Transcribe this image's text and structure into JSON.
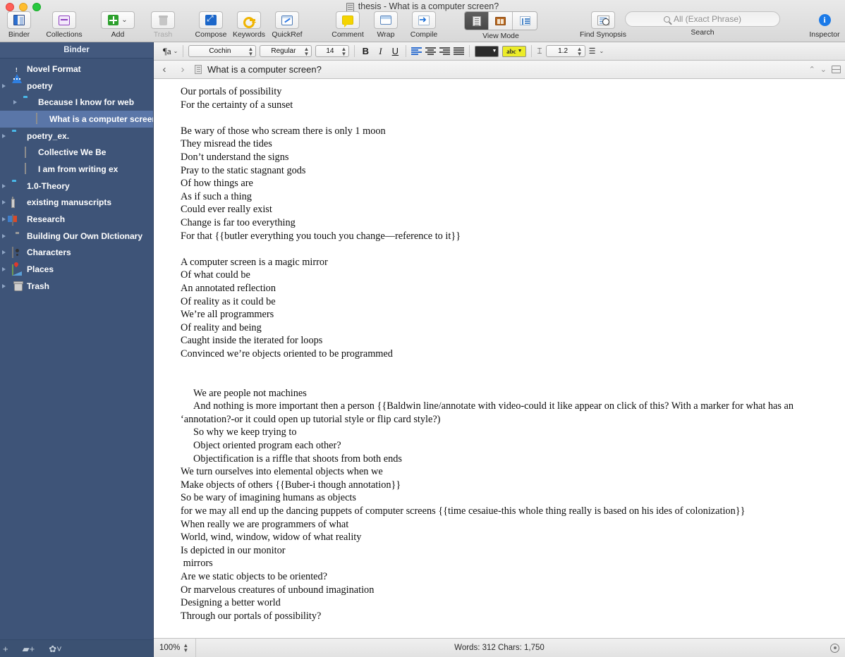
{
  "window": {
    "title": "thesis - What is a computer screen?",
    "title_icon": "document-icon"
  },
  "toolbar": {
    "items": [
      {
        "label": "Binder",
        "icon": "binder-icon",
        "dimmed": false
      },
      {
        "label": "Collections",
        "icon": "collections-icon",
        "dimmed": false
      },
      {
        "label": "Add",
        "icon": "add-plus-icon",
        "dimmed": false
      },
      {
        "label": "Trash",
        "icon": "trash-icon",
        "dimmed": true
      },
      {
        "label": "Compose",
        "icon": "compose-icon",
        "dimmed": false
      },
      {
        "label": "Keywords",
        "icon": "key-icon",
        "dimmed": false
      },
      {
        "label": "QuickRef",
        "icon": "quickref-icon",
        "dimmed": false
      },
      {
        "label": "Comment",
        "icon": "comment-icon",
        "dimmed": false
      },
      {
        "label": "Wrap",
        "icon": "wrap-icon",
        "dimmed": false
      },
      {
        "label": "Compile",
        "icon": "compile-icon",
        "dimmed": false
      },
      {
        "label": "View Mode",
        "icon": "view-mode-segmented",
        "dimmed": false
      },
      {
        "label": "Find Synopsis",
        "icon": "find-synopsis-icon",
        "dimmed": false
      },
      {
        "label": "Search",
        "icon": "search-icon",
        "dimmed": false
      },
      {
        "label": "Inspector",
        "icon": "info-icon",
        "dimmed": false
      }
    ],
    "view_modes": [
      {
        "name": "document-view-mode",
        "active": true
      },
      {
        "name": "corkboard-view-mode",
        "active": false
      },
      {
        "name": "outliner-view-mode",
        "active": false
      }
    ],
    "search": {
      "placeholder": "All (Exact Phrase)",
      "value": ""
    }
  },
  "binder": {
    "header": "Binder",
    "items": [
      {
        "label": "Novel Format",
        "icon": "warning-triangle-icon",
        "indent": 0,
        "disclosure": false,
        "selected": false
      },
      {
        "label": "poetry",
        "icon": "clapperboard-icon",
        "indent": 0,
        "disclosure": true,
        "selected": false
      },
      {
        "label": "Because I know for web",
        "icon": "folder-icon",
        "indent": 1,
        "disclosure": true,
        "selected": false
      },
      {
        "label": "What is a computer screen?",
        "icon": "document-icon",
        "indent": 2,
        "disclosure": false,
        "selected": true
      },
      {
        "label": "poetry_ex.",
        "icon": "folder-icon",
        "indent": 0,
        "disclosure": true,
        "selected": false
      },
      {
        "label": "Collective We Be",
        "icon": "document-icon",
        "indent": 1,
        "disclosure": false,
        "selected": false
      },
      {
        "label": "I am from writing ex",
        "icon": "document-icon",
        "indent": 1,
        "disclosure": false,
        "selected": false
      },
      {
        "label": "1.0-Theory",
        "icon": "folder-icon",
        "indent": 0,
        "disclosure": true,
        "selected": false
      },
      {
        "label": "existing manuscripts",
        "icon": "manuscript-icon",
        "indent": 0,
        "disclosure": true,
        "selected": false
      },
      {
        "label": "Research",
        "icon": "research-book-icon",
        "indent": 0,
        "disclosure": true,
        "selected": false
      },
      {
        "label": "Building Our Own DIctionary",
        "icon": "lightbulb-icon",
        "indent": 0,
        "disclosure": true,
        "selected": false
      },
      {
        "label": "Characters",
        "icon": "character-icon",
        "indent": 0,
        "disclosure": true,
        "selected": false
      },
      {
        "label": "Places",
        "icon": "places-map-icon",
        "indent": 0,
        "disclosure": true,
        "selected": false
      },
      {
        "label": "Trash",
        "icon": "trash-icon",
        "indent": 0,
        "disclosure": true,
        "selected": false
      }
    ],
    "footer": {
      "add_label": "+",
      "add_folder_label": "+",
      "settings_label": "gear"
    }
  },
  "format_bar": {
    "paragraph_style_label": "¶a",
    "font_family": "Cochin",
    "font_style": "Regular",
    "font_size": "14",
    "bold_label": "B",
    "italic_label": "I",
    "underline_label": "U",
    "text_color": "#2b2b2b",
    "highlight_color": "#ecec28",
    "highlight_label": "abc",
    "line_spacing": "1.2"
  },
  "editor_header": {
    "title": "What is a computer screen?",
    "back_label": "‹",
    "forward_label": "›"
  },
  "document": {
    "lines": [
      {
        "text": "Our portals of possibility",
        "indent": false
      },
      {
        "text": "For the certainty of a sunset",
        "indent": false
      },
      {
        "text": "",
        "indent": false
      },
      {
        "text": "Be wary of those who scream there is only 1 moon",
        "indent": false
      },
      {
        "text": "They misread the tides",
        "indent": false
      },
      {
        "text": "Don’t understand the signs",
        "indent": false
      },
      {
        "text": "Pray to the static stagnant gods",
        "indent": false
      },
      {
        "text": "Of how things are",
        "indent": false
      },
      {
        "text": "As if such a thing",
        "indent": false
      },
      {
        "text": "Could ever really exist",
        "indent": false
      },
      {
        "text": "Change is far too everything",
        "indent": false
      },
      {
        "text": "For that {{butler everything you touch you change—reference to it}}",
        "indent": false
      },
      {
        "text": "",
        "indent": false
      },
      {
        "text": "A computer screen is a magic mirror",
        "indent": false
      },
      {
        "text": "Of what could be",
        "indent": false
      },
      {
        "text": "An annotated reflection",
        "indent": false
      },
      {
        "text": "Of reality as it could be",
        "indent": false
      },
      {
        "text": "We’re all programmers",
        "indent": false
      },
      {
        "text": "Of reality and being",
        "indent": false
      },
      {
        "text": "Caught inside the iterated for loops",
        "indent": false
      },
      {
        "text": "Convinced we’re objects oriented to be programmed",
        "indent": false
      },
      {
        "text": "",
        "indent": false
      },
      {
        "text": "",
        "indent": false
      },
      {
        "text": "We are people not machines",
        "indent": true
      },
      {
        "text": "And nothing is more important then a person {{Baldwin line/annotate with video-could it like appear on click of this? With a marker for what has an ‘annotation?-or it could open up tutorial style or flip card style?)",
        "indent": true
      },
      {
        "text": "So why we keep trying to",
        "indent": true
      },
      {
        "text": "Object oriented program each other?",
        "indent": true
      },
      {
        "text": "Objectification is a riffle that shoots from both ends",
        "indent": true
      },
      {
        "text": "We turn ourselves into elemental objects when we",
        "indent": false
      },
      {
        "text": "Make objects of others {{Buber-i though annotation}}",
        "indent": false
      },
      {
        "text": "So be wary of imagining humans as objects",
        "indent": false
      },
      {
        "text": "for we may all end up the dancing puppets of computer screens {{time cesaiue-this whole thing really is based on his ides of colonization}}",
        "indent": false
      },
      {
        "text": "When really we are programmers of what",
        "indent": false
      },
      {
        "text": "World, wind, window, widow of what reality",
        "indent": false
      },
      {
        "text": "Is depicted in our monitor",
        "indent": false
      },
      {
        "text": " mirrors",
        "indent": false
      },
      {
        "text": "Are we static objects to be oriented?",
        "indent": false
      },
      {
        "text": "Or marvelous creatures of unbound imagination",
        "indent": false
      },
      {
        "text": "Designing a better world",
        "indent": false
      },
      {
        "text": "Through our portals of possibility?",
        "indent": false
      }
    ]
  },
  "status_bar": {
    "zoom": "100%",
    "word_count": "Words: 312   Chars: 1,750"
  }
}
